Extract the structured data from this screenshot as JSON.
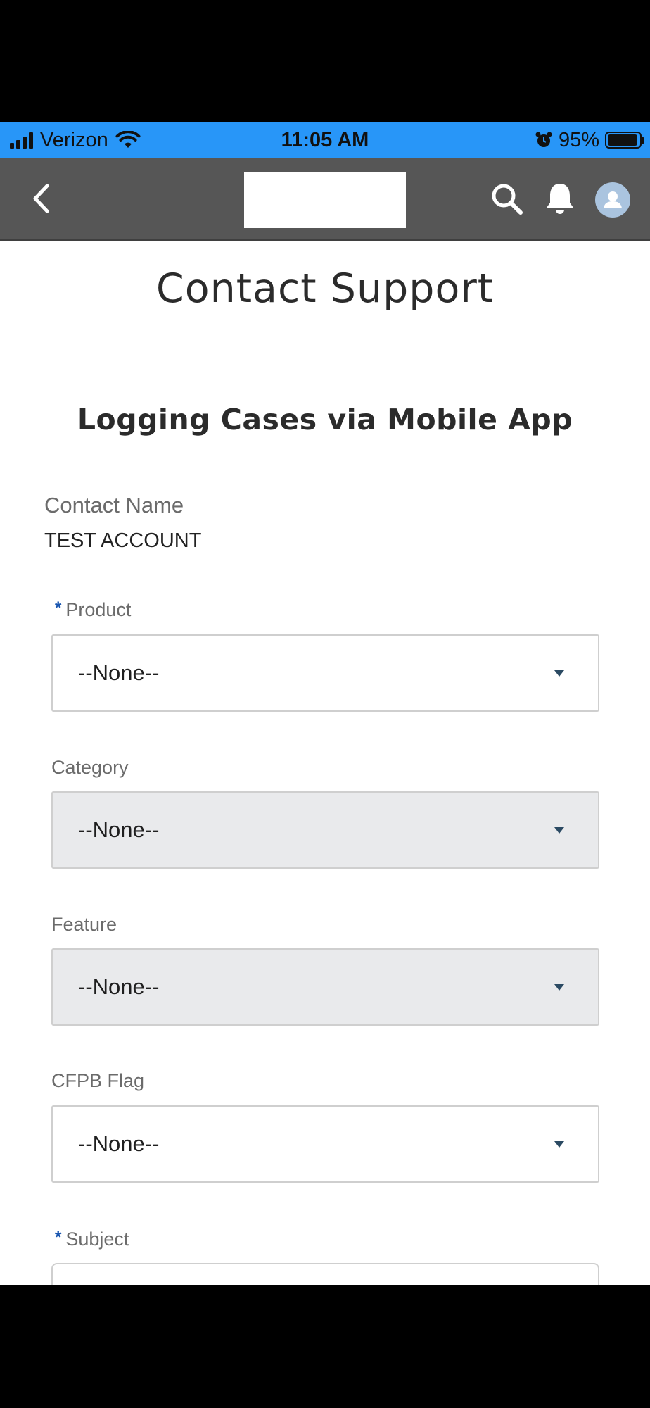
{
  "status_bar": {
    "carrier": "Verizon",
    "time": "11:05 AM",
    "battery": "95%",
    "battery_level": 0.95
  },
  "nav": {
    "back_icon": "chevron-left-icon",
    "search_icon": "search-icon",
    "notifications_icon": "bell-icon",
    "avatar_icon": "user-avatar-icon"
  },
  "page": {
    "title": "Contact Support",
    "section_title": "Logging Cases via Mobile App"
  },
  "contact": {
    "label": "Contact Name",
    "value": "TEST ACCOUNT"
  },
  "form": {
    "required_marker": "*",
    "product": {
      "label": "Product",
      "value": "--None--"
    },
    "category": {
      "label": "Category",
      "value": "--None--"
    },
    "feature": {
      "label": "Feature",
      "value": "--None--"
    },
    "cfpb_flag": {
      "label": "CFPB Flag",
      "value": "--None--"
    },
    "subject": {
      "label": "Subject",
      "value": ""
    }
  },
  "colors": {
    "status_bar": "#2896f8",
    "nav_bar": "#565656",
    "required_marker": "#1a56b0",
    "disabled_field": "#e9eaec"
  }
}
